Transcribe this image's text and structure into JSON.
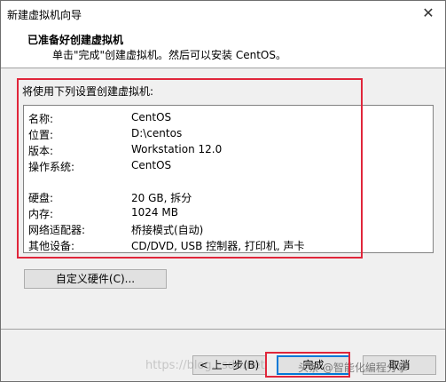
{
  "window": {
    "title": "新建虚拟机向导"
  },
  "header": {
    "title": "已准备好创建虚拟机",
    "subtitle": "单击\"完成\"创建虚拟机。然后可以安装 CentOS。"
  },
  "summary": {
    "heading": "将使用下列设置创建虚拟机:",
    "rows": [
      {
        "label": "名称:",
        "value": "CentOS"
      },
      {
        "label": "位置:",
        "value": "D:\\centos"
      },
      {
        "label": "版本:",
        "value": "Workstation 12.0"
      },
      {
        "label": "操作系统:",
        "value": "CentOS"
      },
      {
        "label": "硬盘:",
        "value": "20 GB, 拆分"
      },
      {
        "label": "内存:",
        "value": "1024 MB"
      },
      {
        "label": "网络适配器:",
        "value": "桥接模式(自动)"
      },
      {
        "label": "其他设备:",
        "value": "CD/DVD, USB 控制器, 打印机, 声卡"
      }
    ]
  },
  "buttons": {
    "customize": "自定义硬件(C)...",
    "back": "< 上一步(B)",
    "finish": "完成",
    "cancel": "取消"
  },
  "watermark": {
    "url": "https://blog.csdn.net",
    "author": "头条 @智能化编程分享"
  },
  "colors": {
    "highlight_box": "#e0263b",
    "primary_button_border": "#0078d7"
  }
}
